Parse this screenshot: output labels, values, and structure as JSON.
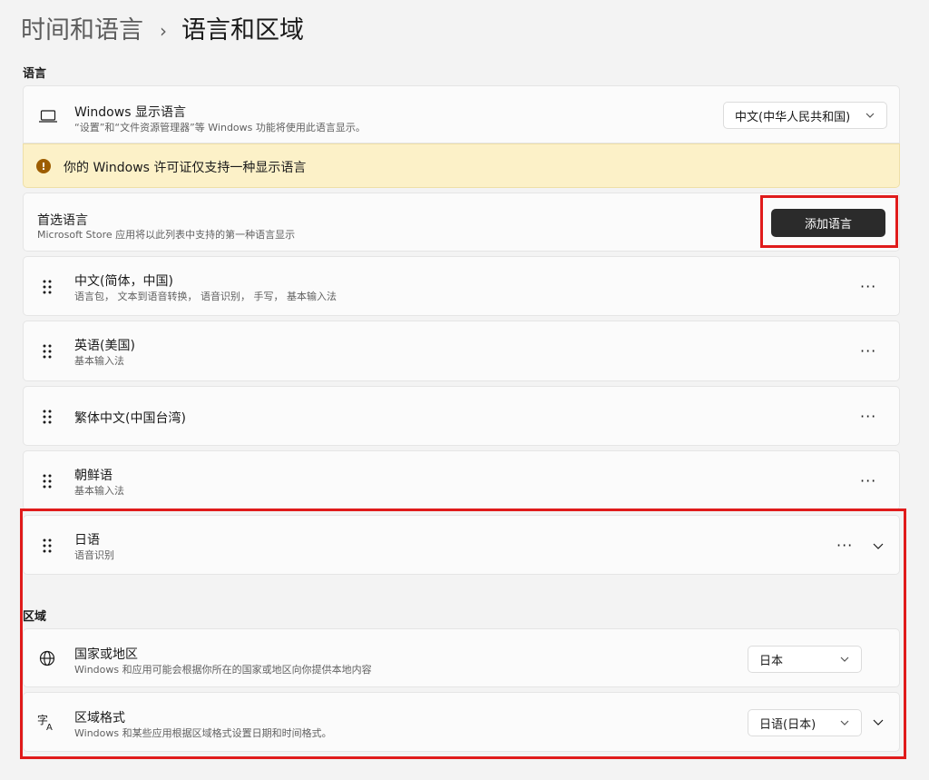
{
  "breadcrumb": {
    "parent": "时间和语言",
    "separator": "›",
    "current": "语言和区域"
  },
  "language_section": {
    "title": "语言"
  },
  "display_language": {
    "title": "Windows 显示语言",
    "subtitle": "“设置”和“文件资源管理器”等 Windows 功能将使用此语言显示。",
    "value": "中文(中华人民共和国)",
    "icon": "laptop-icon"
  },
  "license_warning": {
    "icon": "warning-icon",
    "text": "你的 Windows 许可证仅支持一种显示语言"
  },
  "preferred_languages": {
    "title": "首选语言",
    "subtitle": "Microsoft Store 应用将以此列表中支持的第一种语言显示",
    "add_button": "添加语言"
  },
  "languages": [
    {
      "name": "中文(简体，中国)",
      "features": "语言包， 文本到语音转换， 语音识别， 手写， 基本输入法"
    },
    {
      "name": "英语(美国)",
      "features": "基本输入法"
    },
    {
      "name": "繁体中文(中国台湾)",
      "features": ""
    },
    {
      "name": "朝鲜语",
      "features": "基本输入法"
    },
    {
      "name": "日语",
      "features": "语音识别"
    }
  ],
  "region_section": {
    "title": "区域"
  },
  "country": {
    "title": "国家或地区",
    "subtitle": "Windows 和应用可能会根据你所在的国家或地区向你提供本地内容",
    "value": "日本",
    "icon": "globe-icon"
  },
  "regional_format": {
    "title": "区域格式",
    "subtitle": "Windows 和某些应用根据区域格式设置日期和时间格式。",
    "value": "日语(日本)",
    "icon": "language-format-icon"
  },
  "colors": {
    "accent_dark": "#2b2b2b",
    "highlight": "#e01b1b",
    "warning_bg": "#fcf1c8"
  }
}
